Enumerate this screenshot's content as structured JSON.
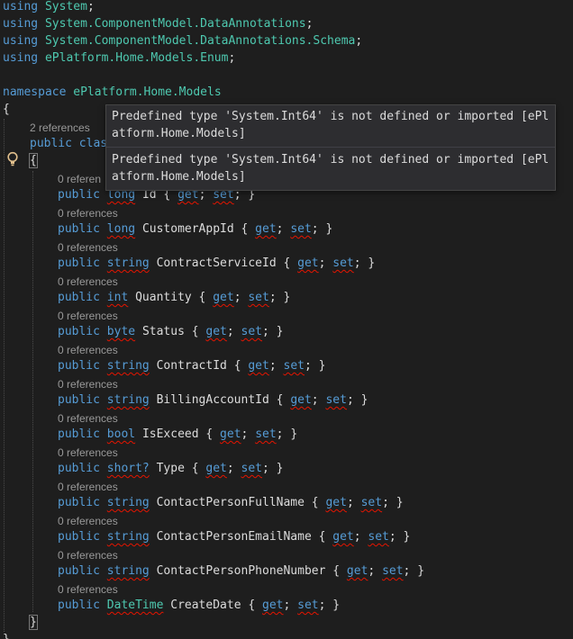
{
  "usings": [
    {
      "kw": "using",
      "ns": "System",
      "semi": ";"
    },
    {
      "kw": "using",
      "ns": "System.ComponentModel.DataAnnotations",
      "semi": ";"
    },
    {
      "kw": "using",
      "ns": "System.ComponentModel.DataAnnotations.Schema",
      "semi": ";"
    },
    {
      "kw": "using",
      "ns": "ePlatform.Home.Models.Enum",
      "semi": ";"
    }
  ],
  "namespace_decl": {
    "kw": "namespace",
    "name": "ePlatform.Home.Models"
  },
  "class_refs": "2 references",
  "class_decl": {
    "kw": "public",
    "partial": "clas"
  },
  "open_brace": "{",
  "close_brace": "}",
  "prop_refs": "0 references",
  "properties": [
    {
      "type": "long",
      "name": "Id",
      "ref": "0 referen"
    },
    {
      "type": "long",
      "name": "CustomerAppId",
      "ref": "0 references"
    },
    {
      "type": "string",
      "name": "ContractServiceId",
      "ref": "0 references"
    },
    {
      "type": "int",
      "name": "Quantity",
      "ref": "0 references"
    },
    {
      "type": "byte",
      "name": "Status",
      "ref": "0 references"
    },
    {
      "type": "string",
      "name": "ContractId",
      "ref": "0 references"
    },
    {
      "type": "string",
      "name": "BillingAccountId",
      "ref": "0 references"
    },
    {
      "type": "bool",
      "name": "IsExceed",
      "ref": "0 references"
    },
    {
      "type": "short?",
      "name": "Type",
      "ref": "0 references"
    },
    {
      "type": "string",
      "name": "ContactPersonFullName",
      "ref": "0 references"
    },
    {
      "type": "string",
      "name": "ContactPersonEmailName",
      "ref": "0 references"
    },
    {
      "type": "string",
      "name": "ContactPersonPhoneNumber",
      "ref": "0 references"
    },
    {
      "type": "DateTime",
      "name": "CreateDate",
      "ref": "0 references"
    }
  ],
  "accessor": {
    "get": "get",
    "set": "set"
  },
  "tooltip": {
    "messages": [
      "Predefined type 'System.Int64' is not defined or imported [ePlatform.Home.Models]",
      "Predefined type 'System.Int64' is not defined or imported [ePlatform.Home.Models]"
    ]
  },
  "colors": {
    "background": "#1e1e1e",
    "keyword": "#569cd6",
    "type": "#4ec9b0",
    "text": "#dcdcdc",
    "codelens": "#999999",
    "squiggle": "#e51400",
    "tooltip_bg": "#2d2d30"
  },
  "icons": {
    "quick_action": "lightbulb-icon"
  }
}
